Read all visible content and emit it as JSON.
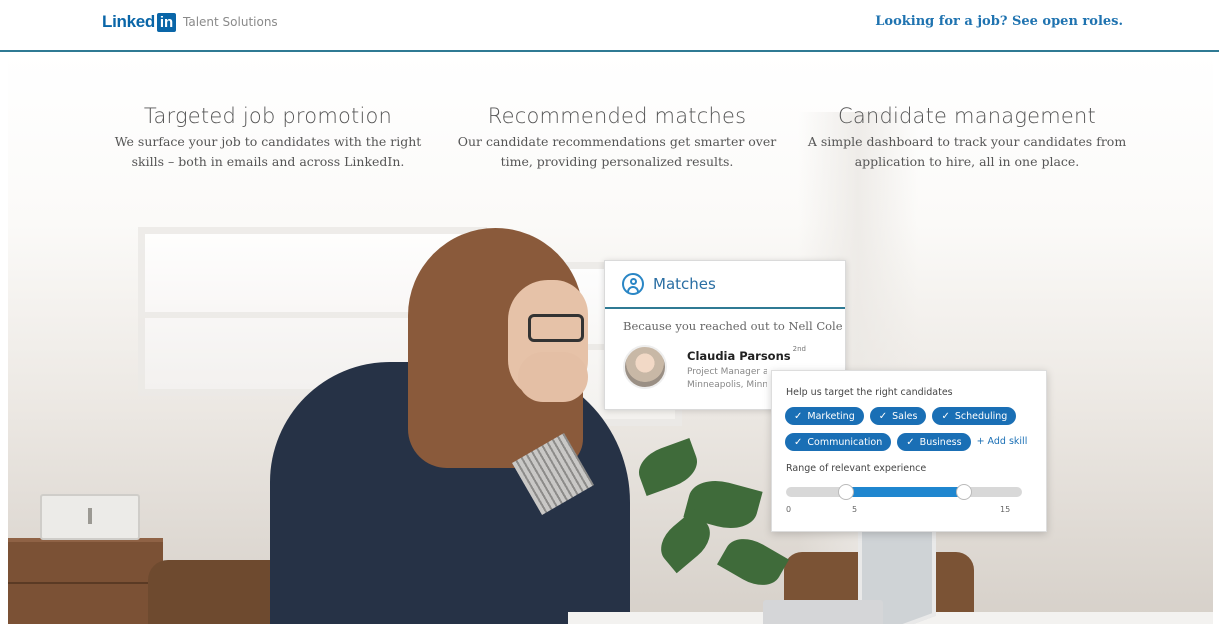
{
  "header": {
    "logo_linked": "Linked",
    "logo_in": "in",
    "logo_product": "Talent Solutions",
    "job_link": "Looking for a job? See open roles."
  },
  "features": [
    {
      "title": "Targeted job promotion",
      "line1": "We surface your job to candidates with the right",
      "line2": "skills – both in emails and across LinkedIn."
    },
    {
      "title": "Recommended matches",
      "line1": "Our candidate recommendations get smarter over",
      "line2": "time, providing personalized results."
    },
    {
      "title": "Candidate management",
      "line1": "A simple dashboard to track your candidates from",
      "line2": "application to hire, all in one place."
    }
  ],
  "matches_card": {
    "title": "Matches",
    "reason": "Because you reached out to Nell Cole",
    "candidate": {
      "name": "Claudia Parsons",
      "degree": "2nd",
      "title": "Project Manager at",
      "location": "Minneapolis, Minn"
    }
  },
  "target_card": {
    "title": "Help us target the right candidates",
    "skills": [
      "Marketing",
      "Sales",
      "Scheduling",
      "Communication",
      "Business"
    ],
    "check_glyph": "✓",
    "add_skill": "+ Add skill",
    "range_label": "Range of relevant experience",
    "ticks": [
      "0",
      "5",
      "15"
    ],
    "slider": {
      "min": 0,
      "max": 20,
      "low": 5,
      "high": 15
    }
  },
  "colors": {
    "brand_blue": "#0a66a8",
    "chip_blue": "#1a6fb5",
    "header_rule": "#2f7a94"
  }
}
